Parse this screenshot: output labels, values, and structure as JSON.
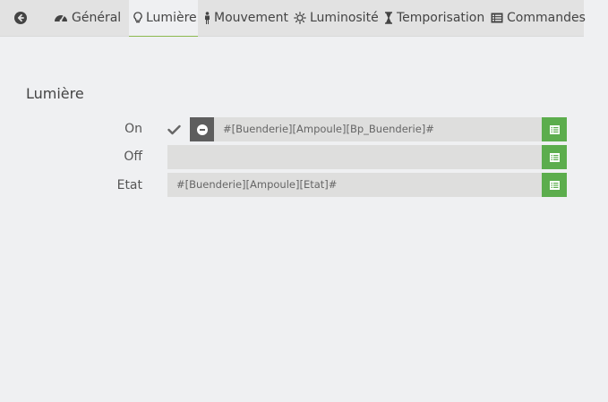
{
  "tabs": [
    {
      "label": "",
      "icon": "arrow-circle-left-icon"
    },
    {
      "label": "Général",
      "icon": "tachometer-icon"
    },
    {
      "label": "Lumière",
      "icon": "lightbulb-icon",
      "active": true
    },
    {
      "label": "Mouvement",
      "icon": "male-icon"
    },
    {
      "label": "Luminosité",
      "icon": "sun-icon"
    },
    {
      "label": "Temporisation",
      "icon": "hourglass-icon"
    },
    {
      "label": "Commandes",
      "icon": "list-alt-icon"
    }
  ],
  "section": {
    "title": "Lumière"
  },
  "rows": {
    "on": {
      "label": "On",
      "value": "#[Buenderie][Ampoule][Bp_Buenderie]#",
      "checked": true
    },
    "off": {
      "label": "Off",
      "value": ""
    },
    "etat": {
      "label": "Etat",
      "value": "#[Buenderie][Ampoule][Etat]#"
    }
  },
  "colors": {
    "accent_green": "#5cad4d",
    "tab_active_border": "#8bb94f",
    "dark_button": "#5e5e5e"
  }
}
